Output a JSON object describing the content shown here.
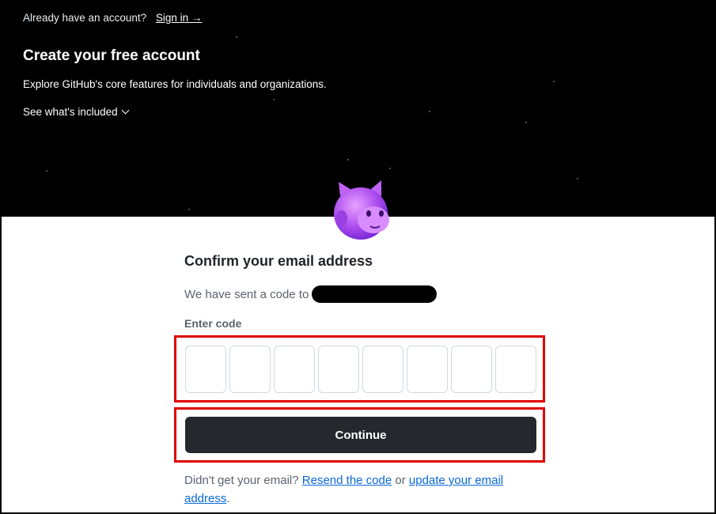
{
  "header": {
    "already_text": "Already have an account?",
    "signin_label": "Sign in →",
    "title": "Create your free account",
    "subtitle": "Explore GitHub's core features for individuals and organizations.",
    "see_included": "See what's included"
  },
  "form": {
    "title": "Confirm your email address",
    "sent_text": "We have sent a code to",
    "code_label": "Enter code",
    "code_digits": [
      "",
      "",
      "",
      "",
      "",
      "",
      "",
      ""
    ],
    "continue_label": "Continue",
    "footer_prefix": "Didn't get your email?",
    "resend_label": "Resend the code",
    "or_text": "or",
    "update_label": "update your email address",
    "period": "."
  },
  "colors": {
    "hero_bg": "#000000",
    "button_bg": "#25292e",
    "link": "#0969da",
    "highlight": "#e00000",
    "mascot": "#b04ff0"
  },
  "icons": {
    "mascot": "github-mona-mascot",
    "chevron": "chevron-down-icon"
  }
}
